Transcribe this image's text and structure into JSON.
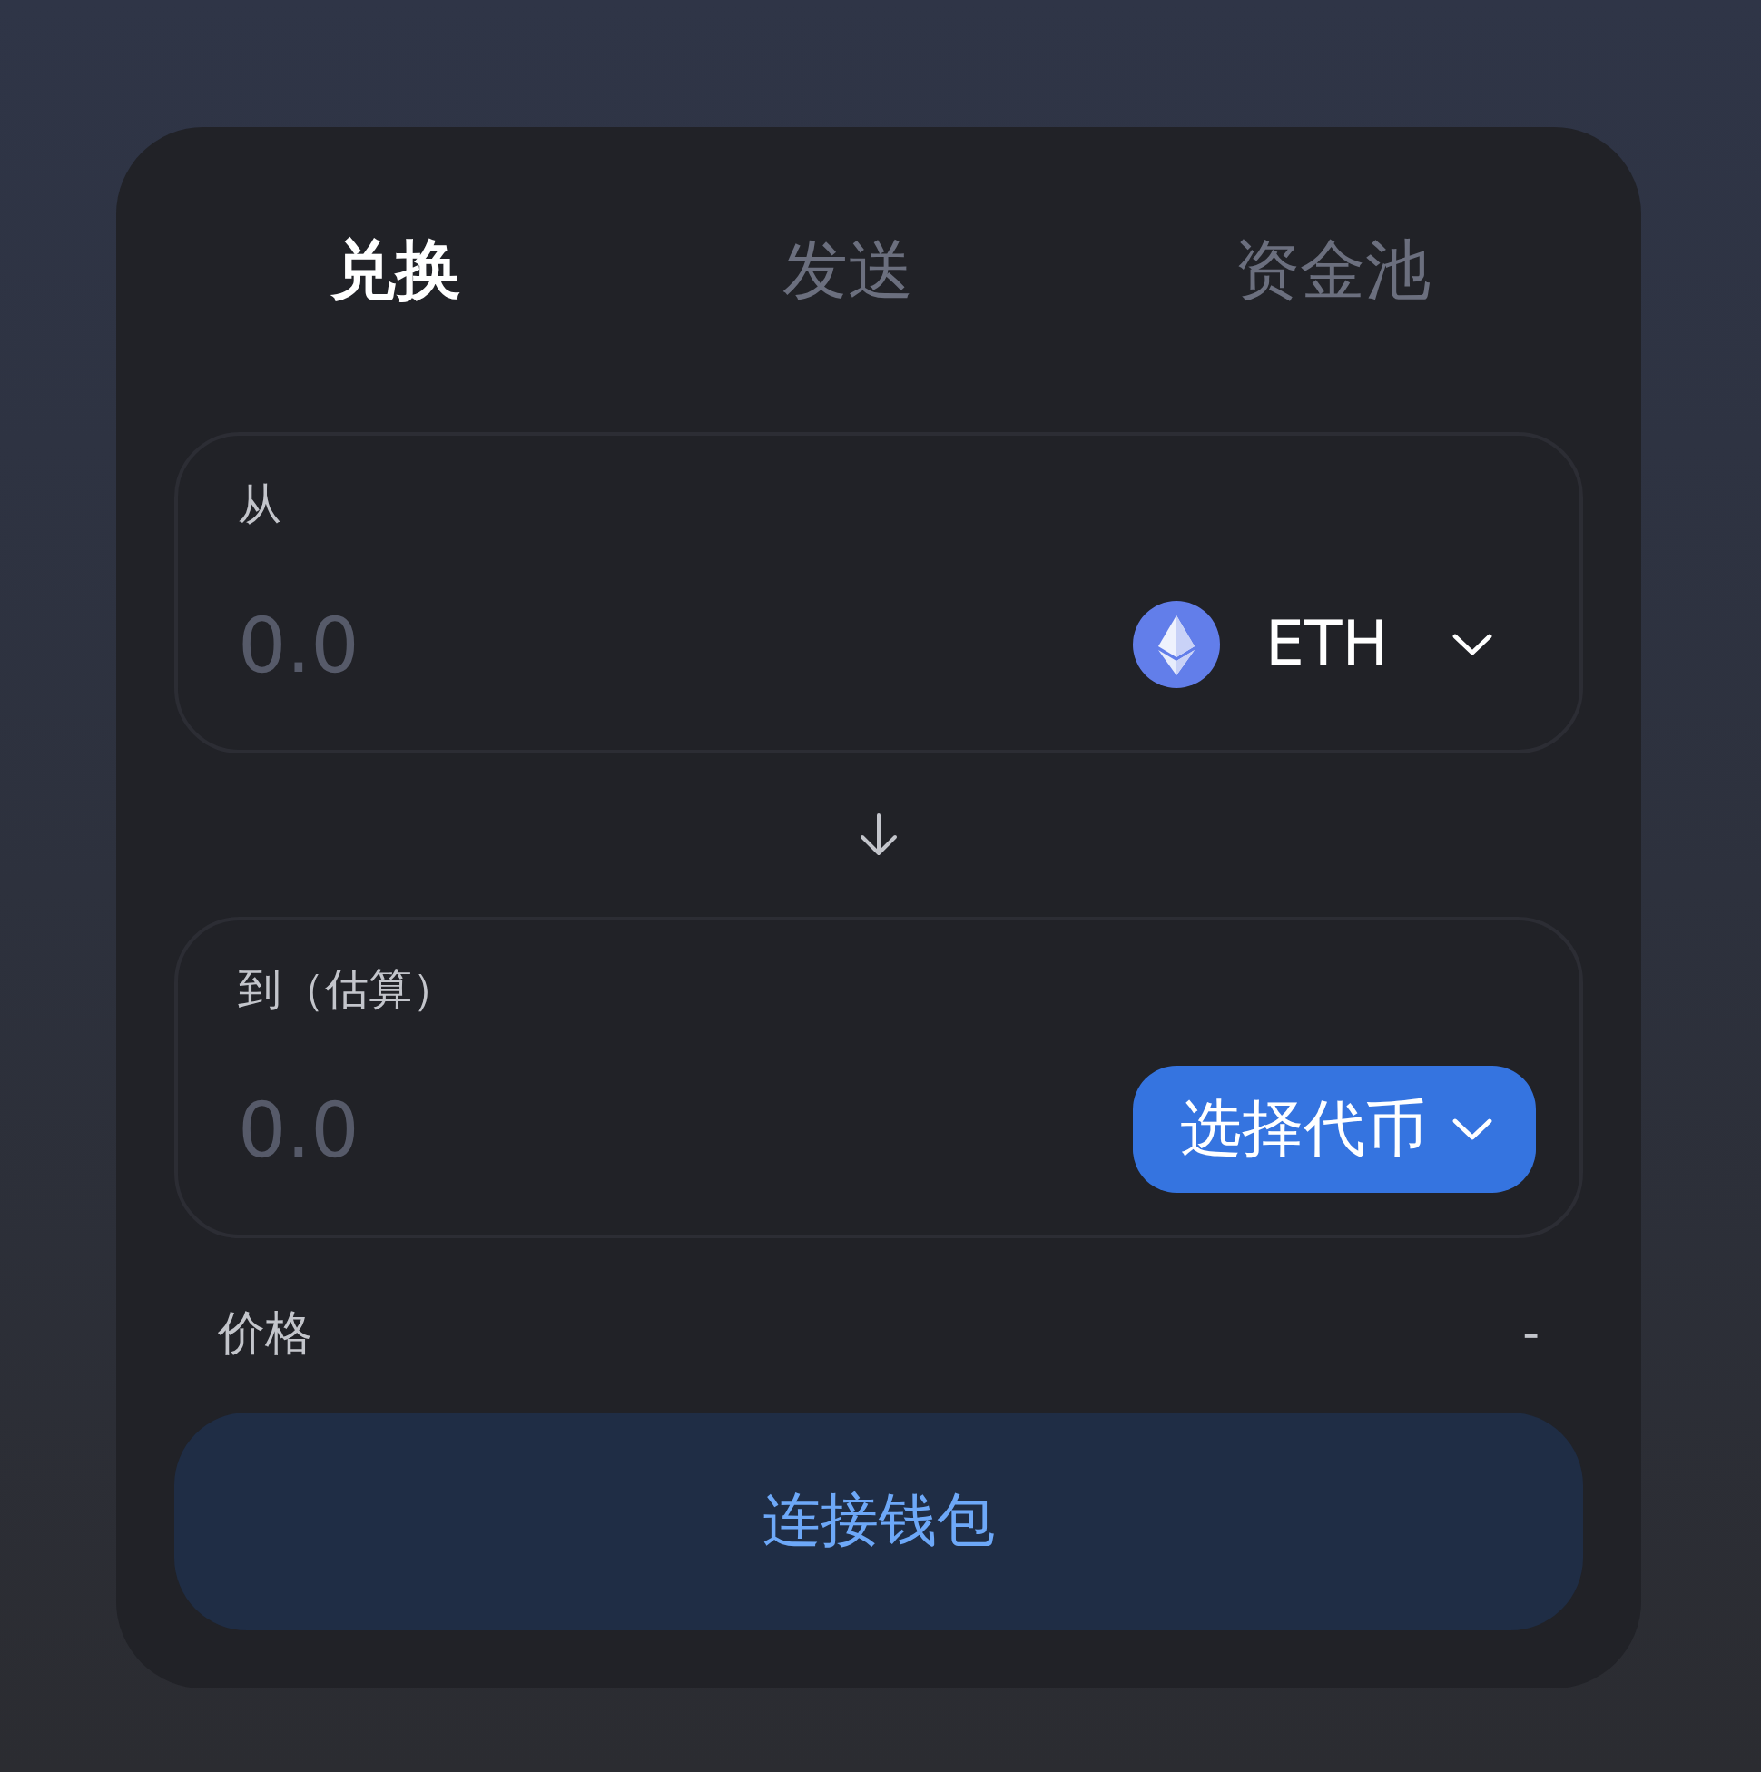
{
  "tabs": [
    {
      "label": "兑换",
      "selected": true
    },
    {
      "label": "发送",
      "selected": false
    },
    {
      "label": "资金池",
      "selected": false
    }
  ],
  "panels": [
    {
      "label": "从",
      "placeholder": "0.0",
      "token": {
        "kind": "token",
        "text": "ETH"
      }
    },
    {
      "label": "到（估算）",
      "placeholder": "0.0",
      "token": {
        "kind": "select",
        "text": "选择代币"
      }
    }
  ],
  "price": {
    "label": "价格",
    "value": "-"
  },
  "connect_button": "连接钱包"
}
